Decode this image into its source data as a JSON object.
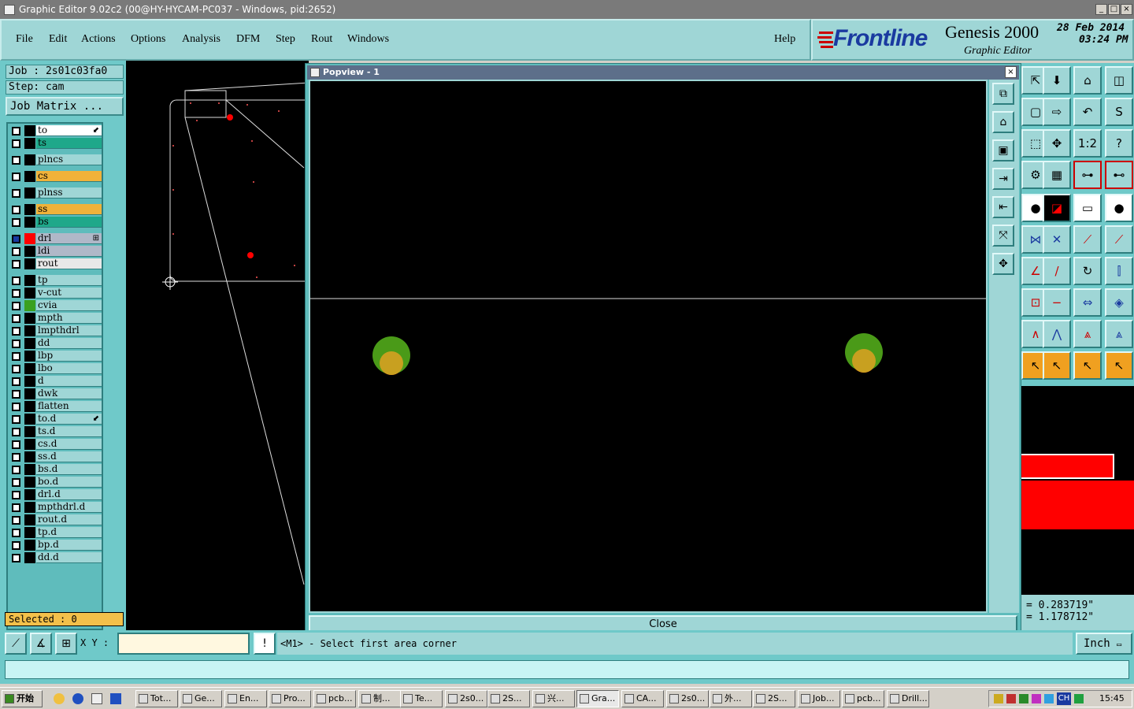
{
  "window": {
    "title": "Graphic Editor 9.02c2 (00@HY-HYCAM-PC037 - Windows, pid:2652)",
    "min": "_",
    "max": "□",
    "close": "×"
  },
  "menu": [
    "File",
    "Edit",
    "Actions",
    "Options",
    "Analysis",
    "DFM",
    "Step",
    "Rout",
    "Windows"
  ],
  "help": "Help",
  "brand": {
    "logo": "Frontline",
    "product": "Genesis 2000",
    "subtitle": "Graphic Editor",
    "date": "28 Feb 2014",
    "time": "03:24 PM"
  },
  "job": {
    "job_label": "Job  : 2s01c03fa0",
    "step_label": "Step: cam",
    "matrix_button": "Job Matrix ..."
  },
  "layers": [
    {
      "name": "to",
      "color": "#000000",
      "bg": "#ffffff",
      "mark": "⬋"
    },
    {
      "name": "ts",
      "color": "#000000",
      "bg": "#1fa88a"
    },
    {
      "name": "plncs",
      "color": "#000000",
      "bg": "#9fd6d6"
    },
    {
      "name": "cs",
      "color": "#000000",
      "bg": "#f0b23a"
    },
    {
      "name": "plnss",
      "color": "#000000",
      "bg": "#9fd6d6"
    },
    {
      "name": "ss",
      "color": "#000000",
      "bg": "#f0b23a"
    },
    {
      "name": "bs",
      "color": "#000000",
      "bg": "#1fa88a"
    },
    {
      "name": "drl",
      "color": "#ff0000",
      "bg": "#b0b8c8",
      "mark": "⊞",
      "check": "#1a3aa0"
    },
    {
      "name": "ldi",
      "color": "#000000",
      "bg": "#b0b8c8"
    },
    {
      "name": "rout",
      "color": "#000000",
      "bg": "#e8e8e8"
    },
    {
      "name": "tp",
      "color": "#000000",
      "bg": "#9fd6d6"
    },
    {
      "name": "v-cut",
      "color": "#000000",
      "bg": "#9fd6d6"
    },
    {
      "name": "cvia",
      "color": "#3aa020",
      "bg": "#9fd6d6"
    },
    {
      "name": "mpth",
      "color": "#000000",
      "bg": "#9fd6d6"
    },
    {
      "name": "lmpthdrl",
      "color": "#000000",
      "bg": "#9fd6d6"
    },
    {
      "name": "dd",
      "color": "#000000",
      "bg": "#9fd6d6"
    },
    {
      "name": "lbp",
      "color": "#000000",
      "bg": "#9fd6d6"
    },
    {
      "name": "lbo",
      "color": "#000000",
      "bg": "#9fd6d6"
    },
    {
      "name": "d",
      "color": "#000000",
      "bg": "#9fd6d6"
    },
    {
      "name": "dwk",
      "color": "#000000",
      "bg": "#9fd6d6"
    },
    {
      "name": "flatten",
      "color": "#000000",
      "bg": "#9fd6d6"
    },
    {
      "name": "to.d",
      "color": "#000000",
      "bg": "#9fd6d6",
      "mark": "⬋"
    },
    {
      "name": "ts.d",
      "color": "#000000",
      "bg": "#9fd6d6"
    },
    {
      "name": "cs.d",
      "color": "#000000",
      "bg": "#9fd6d6"
    },
    {
      "name": "ss.d",
      "color": "#000000",
      "bg": "#9fd6d6"
    },
    {
      "name": "bs.d",
      "color": "#000000",
      "bg": "#9fd6d6"
    },
    {
      "name": "bo.d",
      "color": "#000000",
      "bg": "#9fd6d6"
    },
    {
      "name": "drl.d",
      "color": "#000000",
      "bg": "#9fd6d6"
    },
    {
      "name": "mpthdrl.d",
      "color": "#000000",
      "bg": "#9fd6d6"
    },
    {
      "name": "rout.d",
      "color": "#000000",
      "bg": "#9fd6d6"
    },
    {
      "name": "tp.d",
      "color": "#000000",
      "bg": "#9fd6d6"
    },
    {
      "name": "bp.d",
      "color": "#000000",
      "bg": "#9fd6d6"
    },
    {
      "name": "dd.d",
      "color": "#000000",
      "bg": "#9fd6d6"
    }
  ],
  "selected": "Selected : 0",
  "popview": {
    "title": "Popview - 1",
    "close_x": "×",
    "close_button": "Close"
  },
  "coords": {
    "x": "= 0.283719\"",
    "y": "= 1.178712\""
  },
  "bottom": {
    "xy_label": "X Y :",
    "xy_value": "",
    "prompt": "<M1> - Select first area corner",
    "unit": "Inch"
  },
  "taskbar": {
    "start": "开始",
    "tasks": [
      "Tot...",
      "Ge...",
      "En...",
      "Pro...",
      "pcb...",
      "制...",
      "Te...",
      "2s0...",
      "2S...",
      "兴...",
      "Gra...",
      "CA...",
      "2s0...",
      "外...",
      "2S...",
      "Job...",
      "pcb...",
      "Drill..."
    ],
    "clock": "15:45",
    "lang": "CH"
  }
}
